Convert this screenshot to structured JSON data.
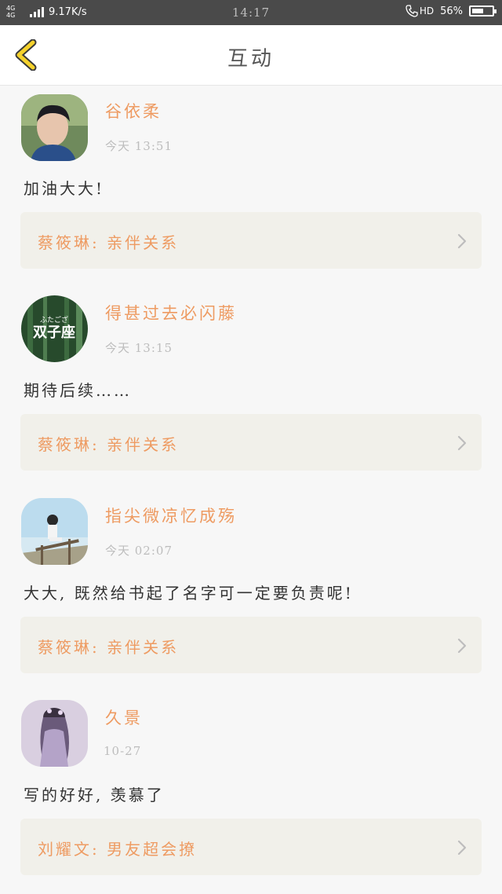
{
  "status_bar": {
    "network": "4G 4G",
    "speed": "9.17K/s",
    "time": "14:17",
    "call_label": "HD",
    "battery": "56%"
  },
  "header": {
    "title": "互动",
    "back_icon": "chevron-left-icon"
  },
  "colors": {
    "accent": "#ee9b62",
    "back_arrow": "#f5d22c",
    "ref_bg": "#f1f0ea",
    "page_bg": "#f7f7f7"
  },
  "items": [
    {
      "name": "谷依柔",
      "time": "今天 13:51",
      "comment": "加油大大!",
      "ref": "蔡筱琳:  亲伴关系"
    },
    {
      "name": "得甚过去必闪藤",
      "time": "今天 13:15",
      "comment": "期待后续……",
      "ref": "蔡筱琳:  亲伴关系",
      "avatar_text_small": "ふたござ",
      "avatar_text": "双子座"
    },
    {
      "name": "指尖微凉忆成殇",
      "time": "今天 02:07",
      "comment": "大大, 既然给书起了名字可一定要负责呢!",
      "ref": "蔡筱琳:  亲伴关系"
    },
    {
      "name": "久景",
      "time": "10-27",
      "comment": "写的好好, 羡慕了",
      "ref": "刘耀文:  男友超会撩"
    }
  ]
}
